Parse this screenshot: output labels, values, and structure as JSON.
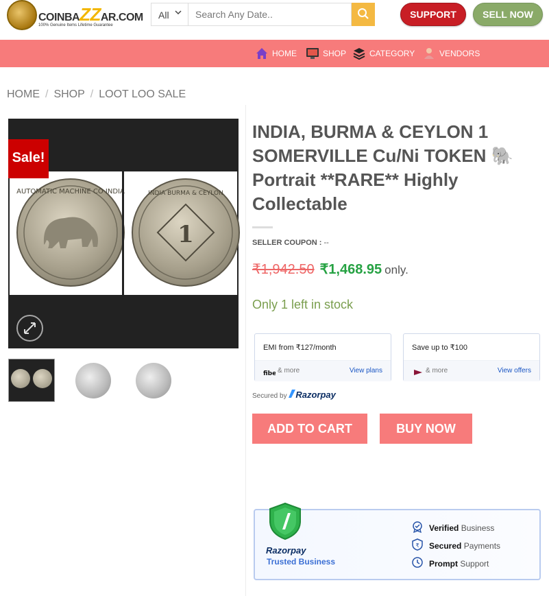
{
  "header": {
    "logo_text_pre": "COINBA",
    "logo_text_zz": "ZZ",
    "logo_text_post": "AR.COM",
    "logo_tagline": "100% Genuine Items Lifetime Guarantee",
    "search_category": "All",
    "search_placeholder": "Search Any Date..",
    "support_label": "SUPPORT",
    "sell_label": "SELL NOW"
  },
  "nav": {
    "items": [
      {
        "label": "HOME"
      },
      {
        "label": "SHOP"
      },
      {
        "label": "CATEGORY"
      },
      {
        "label": "VENDORS"
      }
    ]
  },
  "breadcrumb": [
    "HOME",
    "SHOP",
    "LOOT LOO SALE"
  ],
  "gallery": {
    "sale_badge": "Sale!",
    "coin_left_inscription": "AUTOMATIC MACHINE CO INDIA",
    "coin_right_inscription": "INDIA BURMA & CEYLON",
    "coin_right_value": "1"
  },
  "product": {
    "title": "INDIA, BURMA & CEYLON 1 SOMERVILLE Cu/Ni TOKEN 🐘 Portrait **RARE** Highly Collectable",
    "seller_coupon_label": "SELLER COUPON :",
    "seller_coupon_value": "--",
    "old_price": "₹1,942.50",
    "new_price": "₹1,468.95",
    "price_suffix": "only.",
    "stock": "Only 1 left in stock"
  },
  "razorpay": {
    "emi_heading": "EMI from ₹127/month",
    "emi_more": "& more",
    "emi_link": "View plans",
    "save_heading": "Save up to ₹100",
    "save_more": "& more",
    "save_link": "View offers",
    "secured_prefix": "Secured by",
    "secured_brand": "Razorpay"
  },
  "actions": {
    "add_to_cart": "ADD TO CART",
    "buy_now": "BUY NOW"
  },
  "trust": {
    "brand": "Razorpay",
    "subtitle": "Trusted Business",
    "lines": [
      {
        "strong": "Verified",
        "rest": "Business"
      },
      {
        "strong": "Secured",
        "rest": "Payments"
      },
      {
        "strong": "Prompt",
        "rest": "Support"
      }
    ]
  },
  "colors": {
    "nav_bg": "#f77b7b",
    "support_red": "#c81e25",
    "sell_green": "#8aaa68",
    "price_green": "#26a243",
    "old_price_red": "#e66666"
  }
}
